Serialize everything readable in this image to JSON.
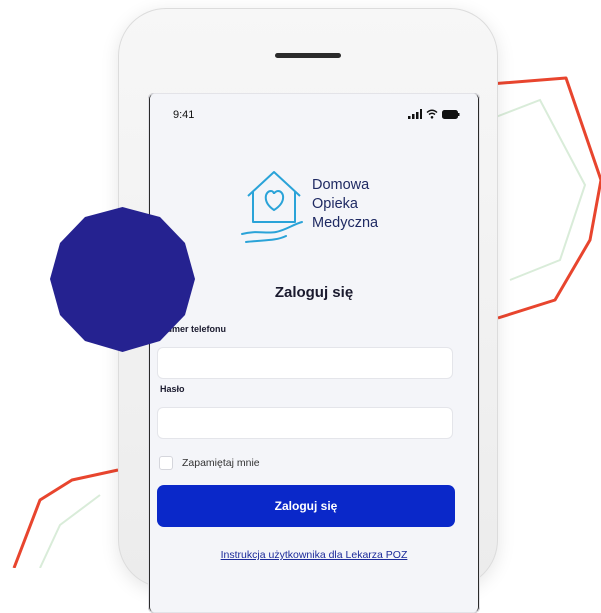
{
  "status_bar": {
    "time": "9:41"
  },
  "logo": {
    "line1": "Domowa",
    "line2": "Opieka",
    "line3": "Medyczna"
  },
  "login_form": {
    "title": "Zaloguj się",
    "phone_label": "Numer telefonu",
    "phone_value": "",
    "password_label": "Hasło",
    "password_value": "",
    "remember_label": "Zapamiętaj mnie",
    "remember_checked": false,
    "submit_label": "Zaloguj się",
    "manual_link": "Instrukcja użytkownika dla Lekarza POZ"
  },
  "colors": {
    "primary_button": "#0a28c9",
    "logo_blue": "#2aa3d8",
    "brand_navy": "#1f2a63",
    "decor_red": "#e8452e",
    "decor_green": "#d9ecd9",
    "decor_circle": "#252290"
  },
  "icons": [
    "house-heart-hand-logo-icon",
    "signal-icon",
    "wifi-icon",
    "battery-icon"
  ]
}
